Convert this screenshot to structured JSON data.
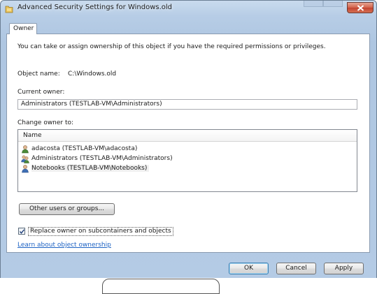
{
  "window": {
    "title": "Advanced Security Settings for Windows.old"
  },
  "tabs": [
    {
      "label": "Owner"
    }
  ],
  "owner_panel": {
    "intro": "You can take or assign ownership of this object if you have the required permissions or privileges.",
    "object_name_label": "Object name:",
    "object_name_value": "C:\\Windows.old",
    "current_owner_label": "Current owner:",
    "current_owner_value": "Administrators (TESTLAB-VM\\Administrators)",
    "change_owner_label": "Change owner to:",
    "list": {
      "header": "Name",
      "items": [
        {
          "name": "adacosta (TESTLAB-VM\\adacosta)",
          "icon": "user-icon"
        },
        {
          "name": "Administrators (TESTLAB-VM\\Administrators)",
          "icon": "group-icon"
        },
        {
          "name": "Notebooks (TESTLAB-VM\\Notebooks)",
          "icon": "user-icon"
        }
      ]
    },
    "other_users_button": "Other users or groups...",
    "replace_owner_checkbox": {
      "label": "Replace owner on subcontainers and objects",
      "checked": true
    },
    "learn_link": "Learn about object ownership"
  },
  "footer": {
    "ok": "OK",
    "cancel": "Cancel",
    "apply": "Apply"
  },
  "colors": {
    "title_bar": "#b7cde6",
    "close_button": "#c9503b",
    "link": "#1e63c4",
    "default_button_border": "#3c7fb1"
  }
}
